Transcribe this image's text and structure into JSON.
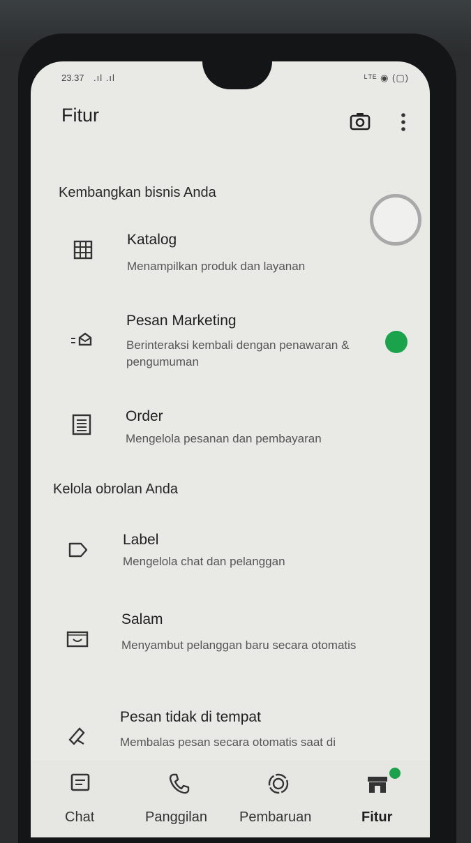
{
  "status": {
    "time": "23.37",
    "signal": ".ıl .ıl",
    "right": "ᴸᵀᴱ ◉ (▢)"
  },
  "appbar": {
    "title": "Fitur",
    "camera_icon": "camera-icon",
    "menu_icon": "more-vert-icon"
  },
  "sections": {
    "business": {
      "title": "Kembangkan bisnis Anda",
      "items": [
        {
          "title": "Katalog",
          "subtitle": "Menampilkan produk dan layanan",
          "icon": "grid-icon"
        },
        {
          "title": "Pesan Marketing",
          "subtitle": "Berinteraksi kembali dengan penawaran & pengumuman",
          "icon": "megaphone-icon"
        },
        {
          "title": "Order",
          "subtitle": "Mengelola pesanan dan pembayaran",
          "icon": "receipt-icon"
        }
      ]
    },
    "chats": {
      "title": "Kelola obrolan Anda",
      "items": [
        {
          "title": "Label",
          "subtitle": "Mengelola chat dan pelanggan",
          "icon": "label-icon"
        },
        {
          "title": "Salam",
          "subtitle": "Menyambut pelanggan baru secara otomatis",
          "icon": "greeting-icon"
        },
        {
          "title": "Pesan tidak di tempat",
          "subtitle": "Membalas pesan secara otomatis saat di",
          "icon": "away-icon"
        }
      ]
    }
  },
  "nav": {
    "items": [
      {
        "label": "Chat",
        "icon": "chat-icon"
      },
      {
        "label": "Panggilan",
        "icon": "phone-icon"
      },
      {
        "label": "Pembaruan",
        "icon": "updates-icon"
      },
      {
        "label": "Fitur",
        "icon": "store-icon",
        "active": true
      }
    ]
  },
  "colors": {
    "accent_green": "#1aa34a",
    "screen_bg": "#e9e9e6"
  }
}
